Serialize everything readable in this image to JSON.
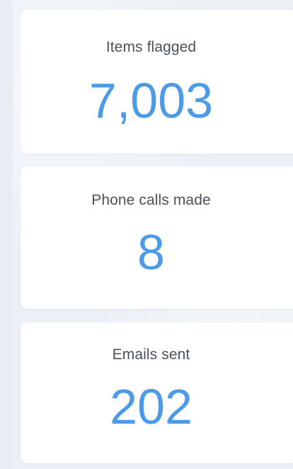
{
  "stats": [
    {
      "label": "Items flagged",
      "value": "7,003"
    },
    {
      "label": "Phone calls made",
      "value": "8"
    },
    {
      "label": "Emails sent",
      "value": "202"
    }
  ],
  "colors": {
    "accent": "#4c9be8",
    "label": "#4b5158",
    "card_background": "#ffffff",
    "page_background": "#eaf0f6"
  }
}
